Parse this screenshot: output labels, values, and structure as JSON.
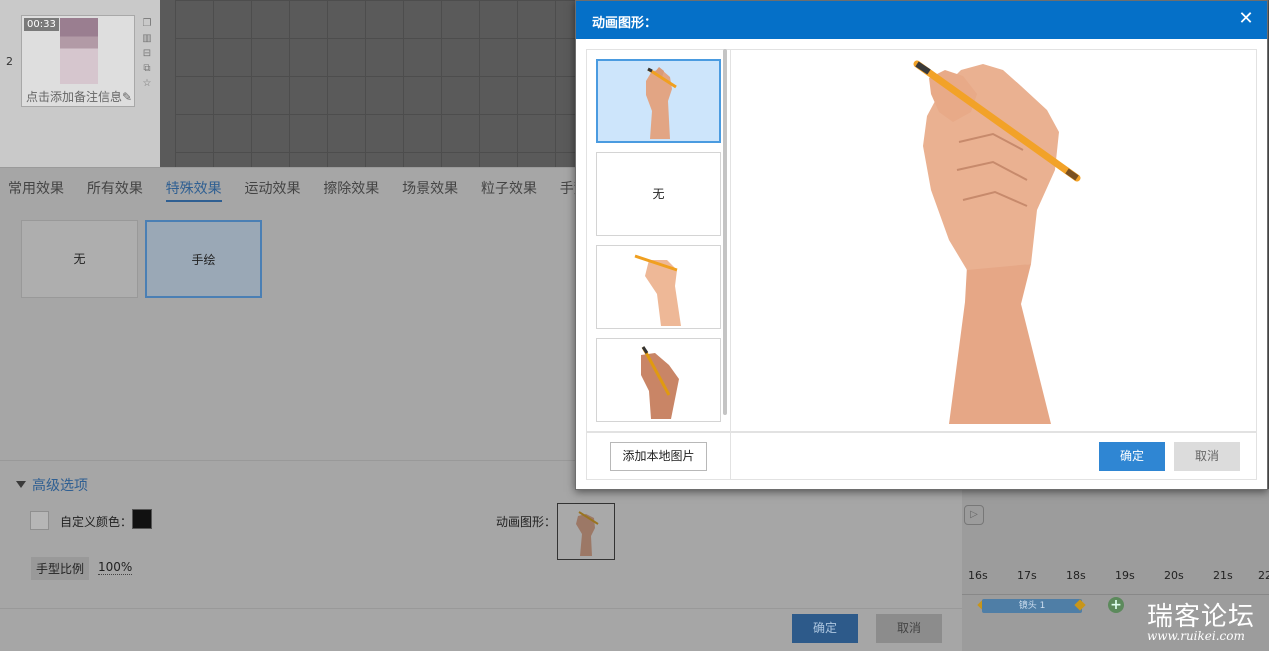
{
  "slide_panel": {
    "slide_number": "2",
    "thumb_time": "00:33",
    "thumb_note": "点击添加备注信息"
  },
  "effects_panel": {
    "tabs": [
      "常用效果",
      "所有效果",
      "特殊效果",
      "运动效果",
      "擦除效果",
      "场景效果",
      "粒子效果",
      "手势"
    ],
    "active_tab": "特殊效果",
    "cards": {
      "none": "无",
      "hand_drawn": "手绘"
    },
    "advanced": {
      "title": "高级选项",
      "custom_color_label": "自定义颜色：",
      "custom_color": "#111111",
      "hand_scale_label": "手型比例",
      "hand_scale_value": "100%",
      "anim_shape_label": "动画图形："
    },
    "ok_label": "确定",
    "cancel_label": "取消"
  },
  "timeline": {
    "ticks": [
      "16s",
      "17s",
      "18s",
      "19s",
      "20s",
      "21s",
      "22"
    ],
    "clip_label": "镜头 1"
  },
  "watermark": {
    "title": "瑞客论坛",
    "url": "www.ruikei.com"
  },
  "dialog": {
    "title": "动画图形：",
    "none_label": "无",
    "add_local_label": "添加本地图片",
    "ok_label": "确定",
    "cancel_label": "取消"
  },
  "colors": {
    "title_bar": "#0570c8",
    "primary_button": "#2f86d3",
    "selected_item_bg": "#cde5fb",
    "selected_item_border": "#4a9be0",
    "active_tab": "#2f5f92",
    "skin": "#e4a886",
    "pencil": "#f0a020"
  },
  "icons": [
    "close-icon",
    "caret-down-icon",
    "add-keyframe-icon",
    "play-icon",
    "copy-icon",
    "delete-icon",
    "duplicate-icon",
    "star-icon",
    "edit-icon"
  ]
}
